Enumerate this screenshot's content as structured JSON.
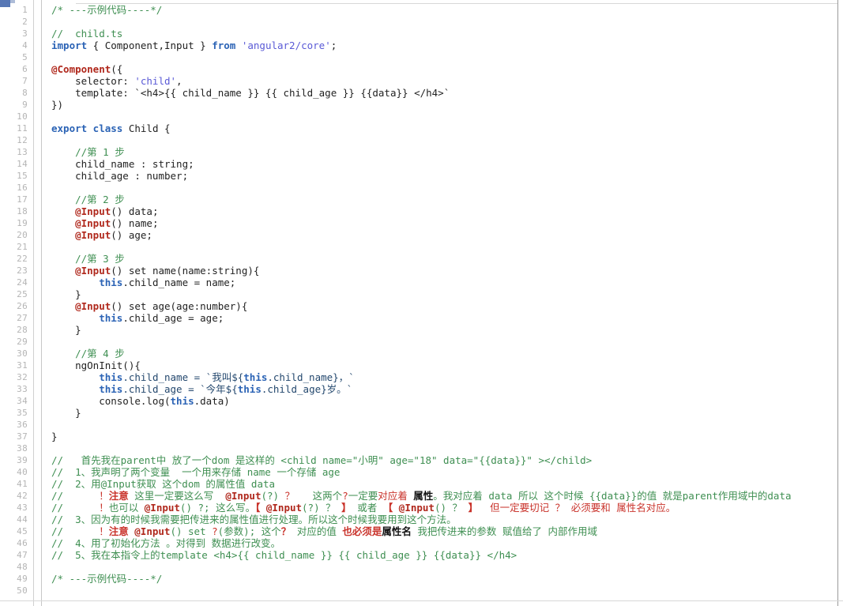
{
  "editor": {
    "title": "child.ts code listing",
    "language": "TypeScript",
    "first_line": 1,
    "last_line": 50,
    "total_lines": 50,
    "colors": {
      "background": "#ffffff",
      "gutter_text": "#b5b5b5",
      "comment": "#3f8f52",
      "keyword": "#2b63b5",
      "string": "#5a5ad6",
      "decorator": "#b0281c",
      "template_literal": "#24486e",
      "emphasis_red": "#c9332b",
      "plain_text": "#222222",
      "gutter_border": "#d0d0d0"
    }
  },
  "line_numbers": [
    1,
    2,
    3,
    4,
    5,
    6,
    7,
    8,
    9,
    10,
    11,
    12,
    13,
    14,
    15,
    16,
    17,
    18,
    19,
    20,
    21,
    22,
    23,
    24,
    25,
    26,
    27,
    28,
    29,
    30,
    31,
    32,
    33,
    34,
    35,
    36,
    37,
    38,
    39,
    40,
    41,
    42,
    43,
    44,
    45,
    46,
    47,
    48,
    49,
    50
  ],
  "lines": {
    "l1": "/* ---示例代码----*/",
    "l2": "",
    "l3": "//  child.ts",
    "l4_kw1": "import",
    "l4_mid": " { Component,Input } ",
    "l4_kw2": "from",
    "l4_str": " 'angular2/core'",
    "l4_end": ";",
    "l5": "",
    "l6_dec": "@Component",
    "l6_rest": "({",
    "l7_key": "    selector: ",
    "l7_str": "'child'",
    "l7_end": ",",
    "l8": "    template: `<h4>{{ child_name }} {{ child_age }} {{data}} </h4>`",
    "l9": "})",
    "l10": "",
    "l11_kw": "export class",
    "l11_rest": " Child {",
    "l12": "",
    "l13": "    //第 1 步",
    "l14": "    child_name : string;",
    "l15": "    child_age : number;",
    "l16": "",
    "l17": "    //第 2 步",
    "l18_dec": "@Input",
    "l18_rest": "() data;",
    "l19_dec": "@Input",
    "l19_rest": "() name;",
    "l20_dec": "@Input",
    "l20_rest": "() age;",
    "l21": "",
    "l22": "    //第 3 步",
    "l23_dec": "@Input",
    "l23_rest": "() set name(name:string){",
    "l24_this": "this",
    "l24_rest": ".child_name = name;",
    "l25": "    }",
    "l26_dec": "@Input",
    "l26_rest": "() set age(age:number){",
    "l27_this": "this",
    "l27_rest": ".child_age = age;",
    "l28": "    }",
    "l29": "",
    "l30": "    //第 4 步",
    "l31": "    ngOnInit(){",
    "l32_this": "this",
    "l32_a": ".child_name = `我叫${",
    "l32_this2": "this",
    "l32_b": ".child_name}，`",
    "l33_this": "this",
    "l33_a": ".child_age = `今年${",
    "l33_this2": "this",
    "l33_b": ".child_age}岁。`",
    "l34_a": "        console.log(",
    "l34_this": "this",
    "l34_b": ".data)",
    "l35": "    }",
    "l36": "",
    "l37": "}",
    "l38": "",
    "l39": "//   首先我在parent中 放了一个dom 是这样的 <child name=\"小明\" age=\"18\" data=\"{{data}}\" ></child>",
    "l40": "//  1、我声明了两个变量  一个用来存储 name 一个存储 age",
    "l41": "//  2、用@Input获取 这个dom 的属性值 data",
    "l42_pre": "//      ",
    "l42_bang": "！",
    "l42_zhuyi": "注意",
    "l42_a": " 这里一定要这么写  ",
    "l42_input": "@Input",
    "l42_b": "(?)",
    "l42_q1": " ？ ",
    "l42_c": "  这两个",
    "l42_q2": "?",
    "l42_d": "一定要",
    "l42_duiying": "对应着",
    "l42_e": " ",
    "l42_shuxing": "属性",
    "l42_f": "。我对应着 data 所以 这个时候 {{data}}的值 就是parent作用域中的data",
    "l43_pre": "//      ",
    "l43_bang": "！",
    "l43_a": "也可以 ",
    "l43_input": "@Input",
    "l43_b": "() ?; 这么写。",
    "l43_br1": "【",
    "l43_c": " ",
    "l43_input2": "@Input",
    "l43_d": "(?) ？ ",
    "l43_br2": "】",
    "l43_e": " 或者 ",
    "l43_br3": "【",
    "l43_f": " ",
    "l43_input3": "@Input",
    "l43_g": "() ？ ",
    "l43_br4": "】",
    "l43_h": "  ",
    "l43_red": "但一定要切记 ？ 必须要和 属性名对应。",
    "l44": "//  3、因为有的时候我需要把传进来的属性值进行处理。所以这个时候我要用到这个方法。",
    "l45_pre": "//      ",
    "l45_bang": "！",
    "l45_zhuyi": "注意",
    "l45_a": " ",
    "l45_input": "@Input",
    "l45_b": "() set ",
    "l45_q": "?",
    "l45_c": "(参数)",
    "l45_d": "; 这个",
    "l45_q2": "？",
    "l45_e": " 对应的值 ",
    "l45_red": "也必须是",
    "l45_blk": "属性名",
    "l45_f": " 我把传进来的参数 赋值给了 内部作用域",
    "l46": "//  4、用了初始化方法 。对得到 数据进行改变。",
    "l47": "//  5、我在本指令上的template <h4>{{ child_name }} {{ child_age }} {{data}} </h4>",
    "l48": "",
    "l49": "/* ---示例代码----*/",
    "l50": ""
  }
}
